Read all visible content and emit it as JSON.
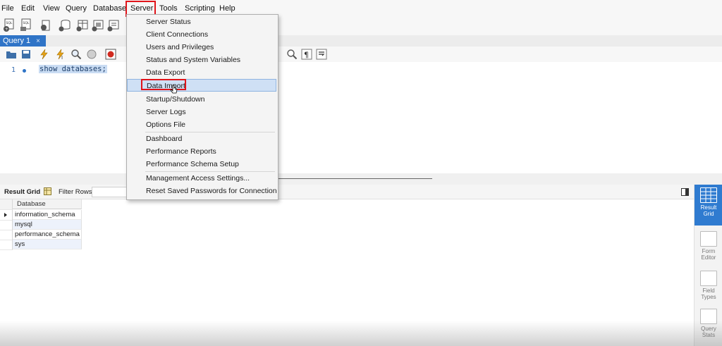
{
  "menubar": {
    "items": [
      "File",
      "Edit",
      "View",
      "Query",
      "Database",
      "Server",
      "Tools",
      "Scripting",
      "Help"
    ],
    "active": "Server"
  },
  "tabs": [
    {
      "label": "Query 1",
      "close": "×"
    }
  ],
  "editor": {
    "line_number": "1",
    "sql": "show databases;"
  },
  "server_menu": {
    "items": [
      "Server Status",
      "Client Connections",
      "Users and Privileges",
      "Status and System Variables",
      "Data Export",
      "Data Import",
      "Startup/Shutdown",
      "Server Logs",
      "Options File",
      "Dashboard",
      "Performance Reports",
      "Performance Schema Setup",
      "Management Access Settings...",
      "Reset Saved Passwords for Connection"
    ],
    "highlighted": "Data Import"
  },
  "result": {
    "result_grid_label": "Result Grid",
    "filter_label": "Filter Rows:",
    "column": "Database",
    "rows": [
      "information_schema",
      "mysql",
      "performance_schema",
      "sys"
    ]
  },
  "side_panel": {
    "buttons": [
      {
        "line1": "Result",
        "line2": "Grid"
      },
      {
        "line1": "Form",
        "line2": "Editor"
      },
      {
        "line1": "Field",
        "line2": "Types"
      },
      {
        "line1": "Query",
        "line2": "Stats"
      }
    ]
  },
  "colors": {
    "accent": "#2f74c7",
    "highlight_box": "#e0141a"
  }
}
